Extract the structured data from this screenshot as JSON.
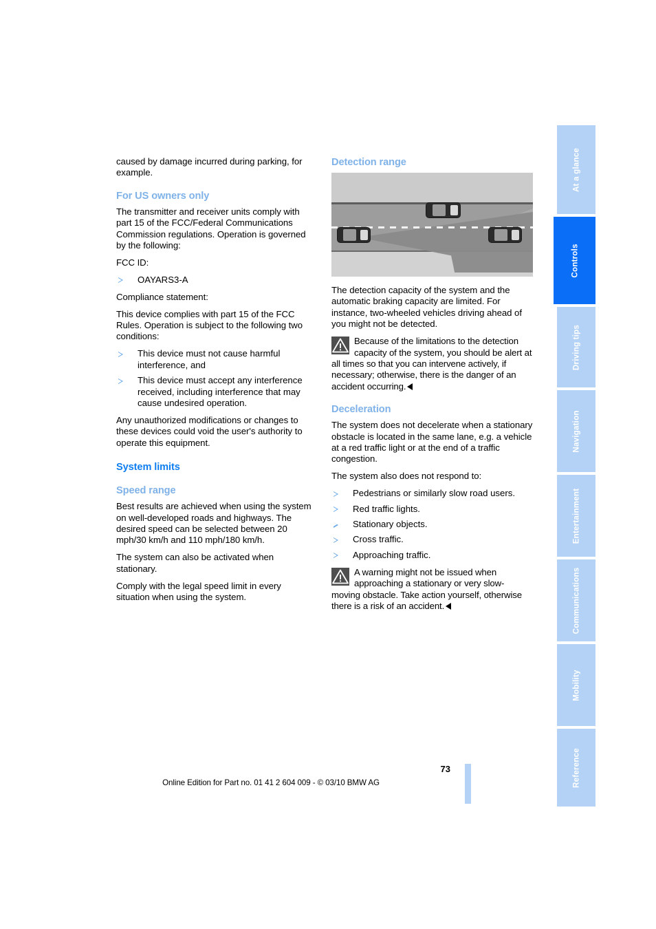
{
  "document": {
    "page_number": "73",
    "footer_note": "Online Edition for Part no. 01 41 2 604 009 - © 03/10 BMW AG"
  },
  "colors": {
    "heading_strong": "#0f7ef0",
    "heading_light": "#7fb2e8",
    "tab_inactive": "#b3d2f5",
    "tab_active": "#0a6ef7",
    "bullet": "#6aa9e9"
  },
  "sidenav": {
    "tabs": [
      {
        "label": "At a glance",
        "active": false
      },
      {
        "label": "Controls",
        "active": true
      },
      {
        "label": "Driving tips",
        "active": false
      },
      {
        "label": "Navigation",
        "active": false
      },
      {
        "label": "Entertainment",
        "active": false
      },
      {
        "label": "Communications",
        "active": false
      },
      {
        "label": "Mobility",
        "active": false
      },
      {
        "label": "Reference",
        "active": false
      }
    ]
  },
  "left_column": {
    "intro_paragraph": "caused by damage incurred during parking, for example.",
    "us_owners": {
      "heading": "For US owners only",
      "paragraph_1": "The transmitter and receiver units comply with part 15 of the FCC/Federal Communications Commission regulations. Operation is governed by the following:",
      "fcc_id_label": "FCC ID:",
      "fcc_id_value": "OAYARS3-A",
      "compliance_label": "Compliance statement:",
      "paragraph_2": "This device complies with part 15 of the FCC Rules. Operation is subject to the following two conditions:",
      "conditions": [
        "This device must not cause harmful interference, and",
        "This device must accept any interference received, including interference that may cause undesired operation."
      ],
      "paragraph_3": "Any unauthorized modifications or changes to these devices could void the user's authority to operate this equipment."
    },
    "system_limits": {
      "heading": "System limits",
      "speed_range": {
        "heading": "Speed range",
        "paragraph_1": "Best results are achieved when using the system on well-developed roads and highways. The desired speed can be selected between 20 mph/30 km/h and 110 mph/180 km/h.",
        "paragraph_2": "The system can also be activated when stationary.",
        "paragraph_3": "Comply with the legal speed limit in every situation when using the system."
      }
    }
  },
  "right_column": {
    "detection_range": {
      "heading": "Detection range",
      "figure": {
        "icon_name": "radar-detection-range-illustration",
        "description": "Top-down road illustration showing a vehicle with a radar detection cone, a vehicle ahead in the same lane, and a vehicle in the adjacent lane"
      },
      "paragraph_1": "The detection capacity of the system and the automatic braking capacity are limited. For instance, two-wheeled vehicles driving ahead of you might not be detected.",
      "warning": "Because of the limitations to the detection capacity of the system, you should be alert at all times so that you can intervene actively, if necessary; otherwise, there is the danger of an accident occurring."
    },
    "deceleration": {
      "heading": "Deceleration",
      "paragraph_1": "The system does not decelerate when a stationary obstacle is located in the same lane, e.g. a vehicle at a red traffic light or at the end of a traffic congestion.",
      "paragraph_2": "The system also does not respond to:",
      "items": [
        "Pedestrians or similarly slow road users.",
        "Red traffic lights.",
        "Stationary objects.",
        "Cross traffic.",
        "Approaching traffic."
      ],
      "warning": "A warning might not be issued when approaching a stationary or very slow-moving obstacle. Take action yourself, otherwise there is a risk of an accident."
    }
  }
}
